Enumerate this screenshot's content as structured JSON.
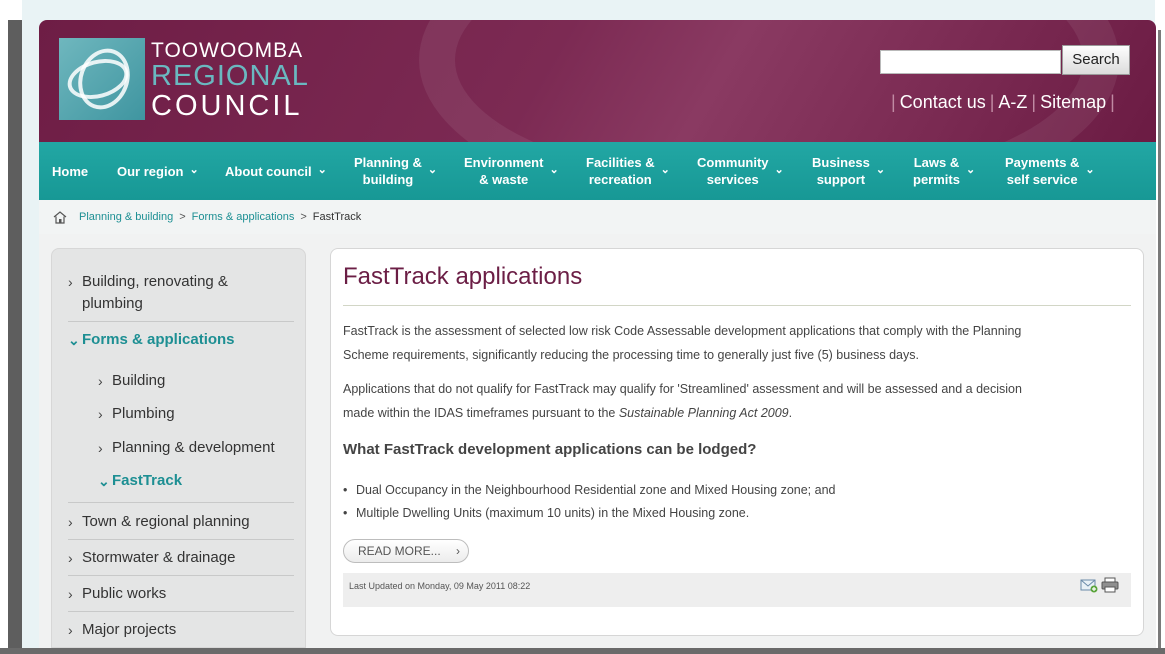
{
  "header": {
    "logo": {
      "line1": "TOOWOOMBA",
      "line2": "REGIONAL",
      "line3": "COUNCIL"
    },
    "search_button": "Search",
    "search_placeholder": "",
    "util_links": [
      "Contact us",
      "A-Z",
      "Sitemap"
    ]
  },
  "nav": {
    "items": [
      {
        "label": "Home"
      },
      {
        "label": "Our region"
      },
      {
        "label": "About council"
      },
      {
        "line1": "Planning &",
        "line2": "building"
      },
      {
        "line1": "Environment",
        "line2": "& waste"
      },
      {
        "line1": "Facilities &",
        "line2": "recreation"
      },
      {
        "line1": "Community",
        "line2": "services"
      },
      {
        "line1": "Business",
        "line2": "support"
      },
      {
        "line1": "Laws &",
        "line2": "permits"
      },
      {
        "line1": "Payments &",
        "line2": "self service"
      }
    ]
  },
  "breadcrumb": {
    "items": [
      "Planning & building",
      "Forms & applications",
      "FastTrack"
    ]
  },
  "sidebar": {
    "items": [
      {
        "line1": "Building, renovating &",
        "line2": "plumbing"
      },
      {
        "label": "Forms & applications"
      },
      {
        "label": "Building"
      },
      {
        "label": "Plumbing"
      },
      {
        "label": "Planning & development"
      },
      {
        "label": "FastTrack"
      },
      {
        "label": "Town & regional planning"
      },
      {
        "label": "Stormwater & drainage"
      },
      {
        "label": "Public works"
      },
      {
        "label": "Major projects"
      }
    ]
  },
  "article": {
    "title": "FastTrack applications",
    "p1_line1": "FastTrack is the assessment of selected low risk Code Assessable development applications that comply with the Planning",
    "p1_line2": "Scheme requirements, significantly reducing the processing time to generally just five (5) business days.",
    "p2_line1": "Applications that do not qualify for FastTrack may qualify for 'Streamlined' assessment and will be assessed and a decision",
    "p2_line2_start": "made within the IDAS timeframes pursuant to the ",
    "p2_line2_italic": "Sustainable Planning Act 2009",
    "p2_line2_end": ".",
    "heading": "What FastTrack development applications can be lodged?",
    "bullets": [
      "Dual Occupancy in the Neighbourhood Residential zone and Mixed Housing zone; and",
      "Multiple Dwelling Units (maximum 10 units) in the Mixed Housing zone."
    ],
    "read_more": "READ MORE...",
    "last_updated": "Last Updated on Monday, 09 May 2011 08:22"
  },
  "icons": {
    "home": "home-icon",
    "email": "email-icon",
    "print": "print-icon",
    "chevron": "chevron-down-icon",
    "arrow": "chevron-right-icon"
  },
  "colors": {
    "header": "#6e1d45",
    "nav": "#1c9f9c",
    "accent": "#1d8f93",
    "title": "#6b1e45"
  }
}
